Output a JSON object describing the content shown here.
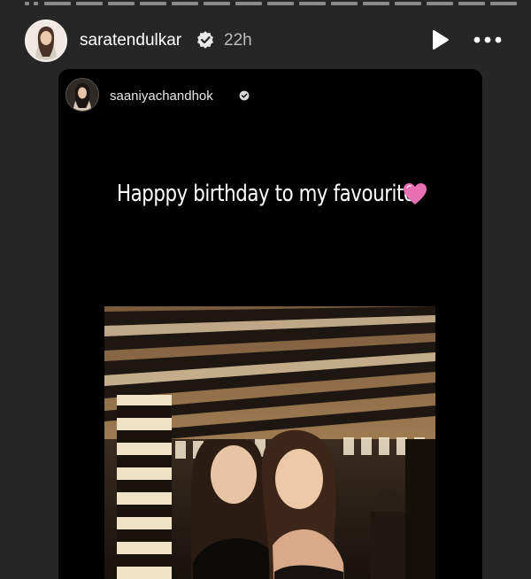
{
  "story": {
    "username": "saratendulkar",
    "time": "22h"
  },
  "icons": {
    "verified": "verified-badge-icon",
    "play": "play-icon",
    "more": "more-options-icon",
    "heart": "pink-heart-emoji"
  },
  "shared_post": {
    "username": "saaniyachandhok",
    "caption": "Happpy birthday to my favourite"
  },
  "colors": {
    "background": "#262626",
    "card": "#000000",
    "heart": "#e86fb4"
  }
}
